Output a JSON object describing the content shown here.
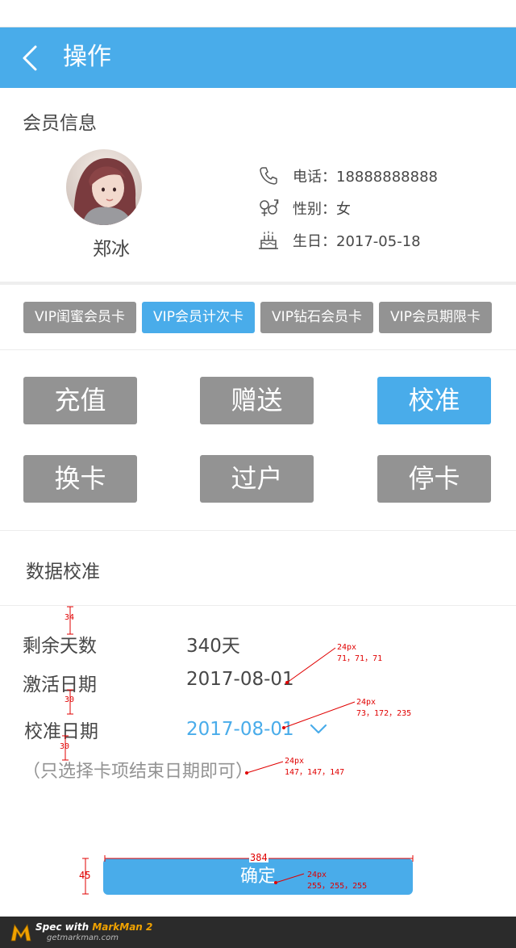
{
  "header": {
    "title": "操作"
  },
  "member": {
    "section_title": "会员信息",
    "name": "郑冰",
    "phone": "电话：18888888888",
    "gender": "性别：女",
    "birthday": "生日：2017-05-18"
  },
  "cards": [
    {
      "label": "VIP闺蜜会员卡"
    },
    {
      "label": "VIP会员计次卡"
    },
    {
      "label": "VIP钻石会员卡"
    },
    {
      "label": "VIP会员期限卡"
    }
  ],
  "actions": [
    {
      "label": "充值"
    },
    {
      "label": "赠送"
    },
    {
      "label": "校准"
    },
    {
      "label": "换卡"
    },
    {
      "label": "过户"
    },
    {
      "label": "停卡"
    }
  ],
  "calibration": {
    "title": "数据校准",
    "remaining_label": "剩余天数",
    "remaining_value": "340天",
    "activated_label": "激活日期",
    "activated_value": "2017-08-01",
    "calib_label": "校准日期",
    "calib_value": "2017-08-01",
    "hint": "（只选择卡项结束日期即可）"
  },
  "confirm_label": "确定",
  "annotations": {
    "gap1": "34",
    "gap2": "30",
    "gap3": "30",
    "spec1_size": "24px",
    "spec1_color": "71，71，71",
    "spec2_size": "24px",
    "spec2_color": "73，172，235",
    "spec3_size": "24px",
    "spec3_color": "147，147，147",
    "btn_width": "384",
    "btn_height": "45",
    "spec4_size": "24px",
    "spec4_color": "255，255，255"
  },
  "footer": {
    "brand_prefix": "Spec with ",
    "brand_name": "MarkMan 2",
    "site": "getmarkman.com"
  },
  "colors": {
    "primary": "#49acea",
    "gray_button": "#939393",
    "text": "#474747",
    "hint": "#939393",
    "annotation": "#e00000"
  }
}
